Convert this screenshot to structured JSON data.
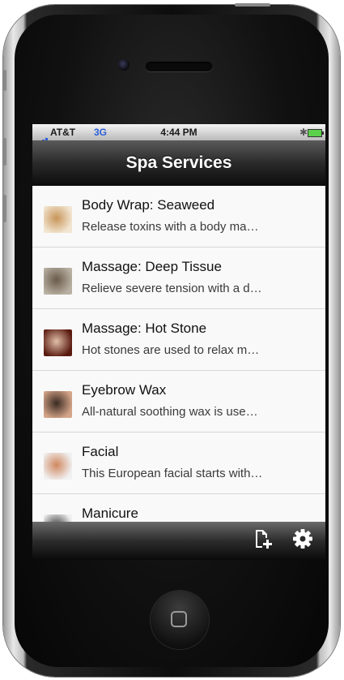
{
  "status_bar": {
    "carrier": "AT&T",
    "network": "3G",
    "time": "4:44 PM",
    "bluetooth_icon": "bluetooth-icon",
    "battery_icon": "battery-icon"
  },
  "nav": {
    "title": "Spa Services"
  },
  "services": [
    {
      "title": "Body Wrap: Seaweed",
      "description": "Release toxins with a body ma…",
      "thumb_colors": [
        "#f2e6d2",
        "#c8955a"
      ]
    },
    {
      "title": "Massage: Deep Tissue",
      "description": "Relieve severe tension with a d…",
      "thumb_colors": [
        "#b8b0a2",
        "#6a5a4a"
      ]
    },
    {
      "title": "Massage: Hot Stone",
      "description": "Hot stones are used to relax m…",
      "thumb_colors": [
        "#5a1a10",
        "#e0c0a8"
      ]
    },
    {
      "title": "Eyebrow Wax",
      "description": "All-natural soothing wax is use…",
      "thumb_colors": [
        "#d4a488",
        "#3a2a22"
      ]
    },
    {
      "title": "Facial",
      "description": "This European facial starts with…",
      "thumb_colors": [
        "#f0f0f0",
        "#d08860"
      ]
    },
    {
      "title": "Manicure",
      "description": "",
      "thumb_colors": [
        "#f0f0f0",
        "#3a3a3a"
      ]
    }
  ],
  "toolbar": {
    "add_icon": "add-document-icon",
    "settings_icon": "gear-icon"
  }
}
